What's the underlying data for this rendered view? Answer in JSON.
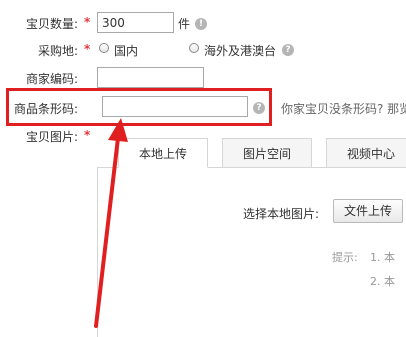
{
  "form": {
    "quantity": {
      "label": "宝贝数量:",
      "required_mark": "*",
      "value": "300",
      "unit": "件"
    },
    "purchase_location": {
      "label": "采购地:",
      "required_mark": "*",
      "options": [
        "国内",
        "海外及港澳台"
      ]
    },
    "merchant_code": {
      "label": "商家编码:",
      "value": ""
    },
    "barcode": {
      "label": "商品条形码:",
      "value": "",
      "hint_text": "你家宝贝没条形码? 那览"
    },
    "images": {
      "label": "宝贝图片:",
      "required_mark": "*"
    }
  },
  "upload": {
    "tabs": [
      "本地上传",
      "图片空间",
      "视频中心"
    ],
    "active_tab": "本地上传",
    "choose_label": "选择本地图片:",
    "upload_button": "文件上传",
    "tips_prefix": "提示:",
    "tips": [
      "1. 本",
      "2. 本"
    ]
  },
  "annotation": {
    "highlight_color": "#e02020"
  }
}
